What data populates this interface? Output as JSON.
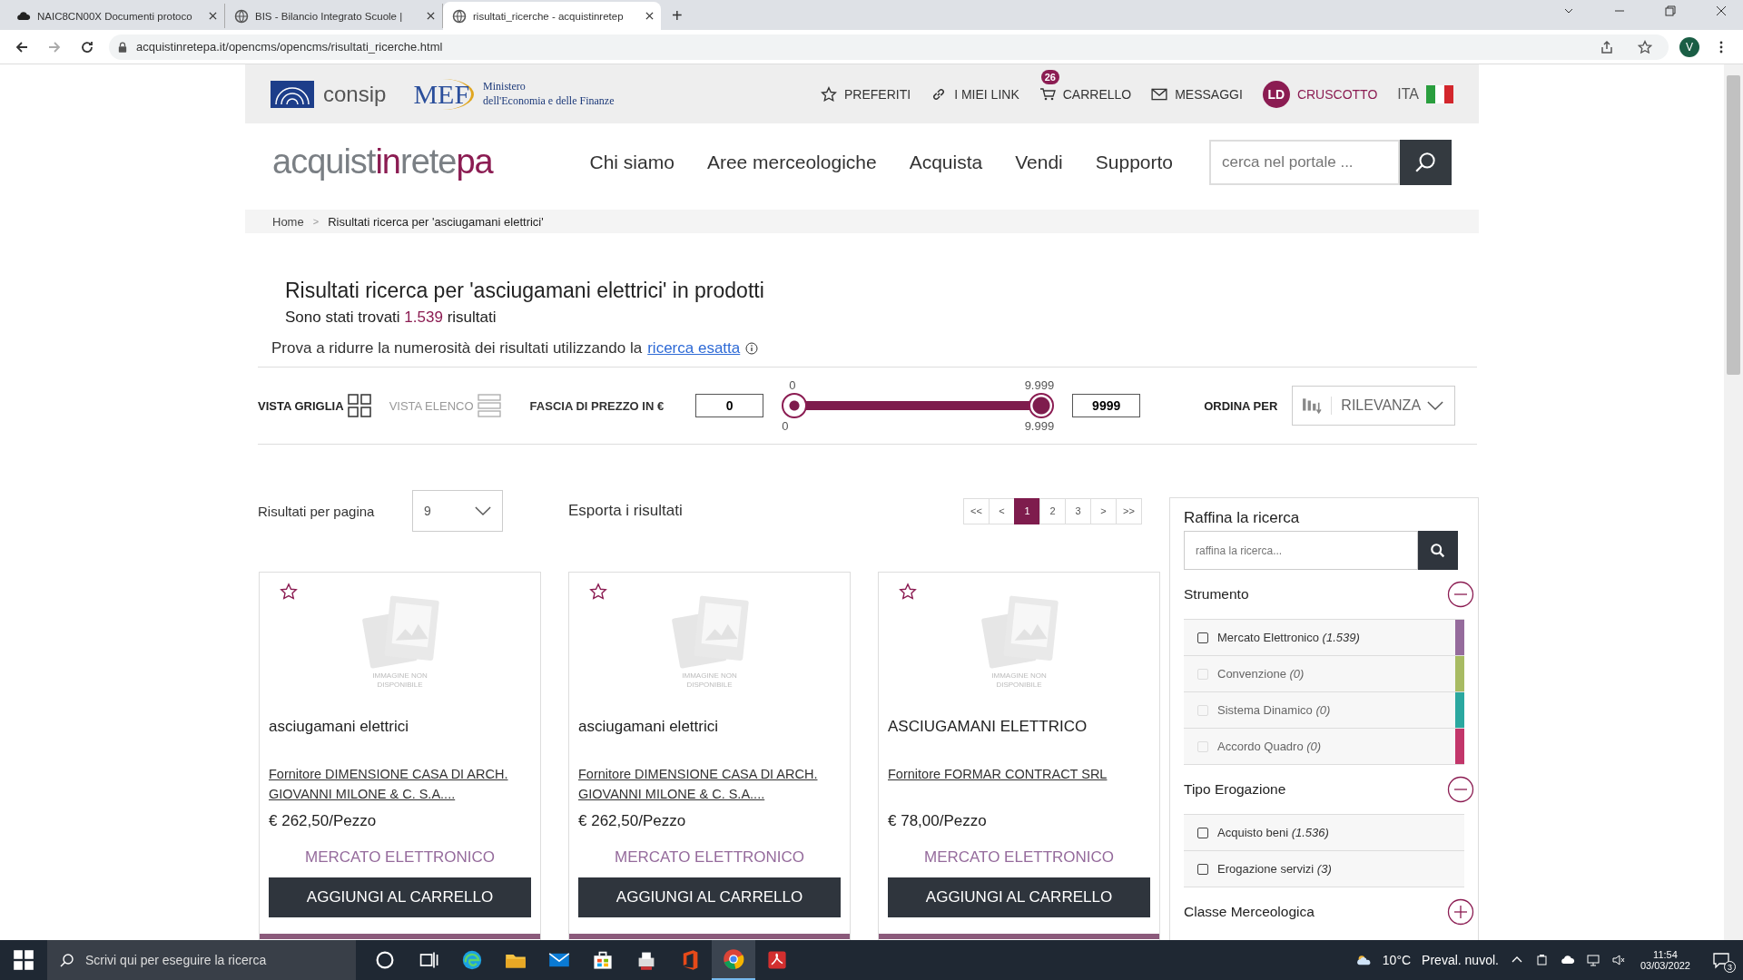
{
  "browser": {
    "tabs": [
      {
        "title": "NAIC8CN00X Documenti protoco",
        "selected": false
      },
      {
        "title": "BIS - Bilancio Integrato Scuole |",
        "selected": false
      },
      {
        "title": "risultati_ricerche - acquistinretep",
        "selected": true
      }
    ],
    "new_tab": "+",
    "url": "acquistinretepa.it/opencms/opencms/risultati_ricerche.html",
    "profile": "V"
  },
  "topbar": {
    "consip": "consip",
    "mef": "MEF",
    "ministry": [
      "Ministero",
      "dell'Economia e delle Finanze"
    ],
    "links": [
      {
        "label": "PREFERITI",
        "kind": "star"
      },
      {
        "label": "I MIEI LINK",
        "kind": "link"
      },
      {
        "label": "CARRELLO",
        "kind": "cart",
        "badge": "26"
      },
      {
        "label": "MESSAGGI",
        "kind": "mail"
      },
      {
        "label": "CRUSCOTTO",
        "kind": "avatar",
        "avatar": "LD"
      }
    ],
    "language": "ITA"
  },
  "header": {
    "logo": [
      {
        "text": "acquist",
        "accent": false
      },
      {
        "text": "in",
        "accent": true
      },
      {
        "text": "rete",
        "accent": false
      },
      {
        "text": "pa",
        "accent": true
      }
    ],
    "nav": [
      "Chi siamo",
      "Aree merceologiche",
      "Acquista",
      "Vendi",
      "Supporto"
    ],
    "search_placeholder": "cerca nel portale ..."
  },
  "breadcrumb": {
    "items": [
      "Home",
      "Risultati ricerca per 'asciugamani elettrici'"
    ],
    "separator": ">"
  },
  "results": {
    "title": "Risultati ricerca per 'asciugamani elettrici' in prodotti",
    "count_prefix": "Sono stati trovati",
    "count": "1.539",
    "count_suffix": "risultati",
    "hint": "Prova a ridurre la numerosità dei risultati utilizzando la",
    "hint_link": "ricerca esatta"
  },
  "filters": {
    "views": [
      {
        "label": "VISTA GRIGLIA",
        "kind": "grid",
        "selected": true
      },
      {
        "label": "VISTA ELENCO",
        "kind": "list",
        "selected": false
      }
    ],
    "price_label": "FASCIA DI PREZZO IN €",
    "price_min": "0",
    "price_max": "9999",
    "slider": {
      "top_low": "0",
      "top_high": "9.999",
      "bottom_low": "0",
      "bottom_high": "9.999",
      "thumbs": [
        {
          "level": 0
        },
        {
          "level": 1
        }
      ]
    },
    "sort_label": "ORDINA PER",
    "sort_value": "RILEVANZA"
  },
  "listing": {
    "per_page_label": "Risultati per pagina",
    "per_page": "9",
    "export": "Esporta i risultati",
    "pagination": [
      {
        "label": "<<",
        "selected": false
      },
      {
        "label": "<",
        "selected": false
      },
      {
        "label": "1",
        "selected": true
      },
      {
        "label": "2",
        "selected": false
      },
      {
        "label": "3",
        "selected": false
      },
      {
        "label": ">",
        "selected": false
      },
      {
        "label": ">>",
        "selected": false
      }
    ]
  },
  "products": [
    {
      "image_text": "IMMAGINE NON DISPONIBILE",
      "name": "asciugamani elettrici",
      "supplier": "Fornitore DIMENSIONE CASA DI ARCH. GIOVANNI MILONE & C. S.A....",
      "price": "€ 262,50/Pezzo",
      "channel": "MERCATO ELETTRONICO",
      "button": "AGGIUNGI AL CARRELLO"
    },
    {
      "image_text": "IMMAGINE NON DISPONIBILE",
      "name": "asciugamani elettrici",
      "supplier": "Fornitore DIMENSIONE CASA DI ARCH. GIOVANNI MILONE & C. S.A....",
      "price": "€ 262,50/Pezzo",
      "channel": "MERCATO ELETTRONICO",
      "button": "AGGIUNGI AL CARRELLO"
    },
    {
      "image_text": "IMMAGINE NON DISPONIBILE",
      "name": "ASCIUGAMANI ELETTRICO",
      "supplier": "Fornitore FORMAR CONTRACT SRL",
      "price": "€ 78,00/Pezzo",
      "channel": "MERCATO ELETTRONICO",
      "button": "AGGIUNGI AL CARRELLO"
    }
  ],
  "sidebar": {
    "title": "Raffina la ricerca",
    "placeholder": "raffina la ricerca...",
    "sections": [
      {
        "title": "Strumento",
        "expanded": true,
        "options": [
          {
            "label": "Mercato Elettronico",
            "count": "(1.539)",
            "checked": false,
            "disabled": false,
            "color": "#956b9c"
          },
          {
            "label": "Convenzione",
            "count": "(0)",
            "checked": false,
            "disabled": true,
            "color": "#a8bb63"
          },
          {
            "label": "Sistema Dinamico",
            "count": "(0)",
            "checked": false,
            "disabled": true,
            "color": "#2ba8a0"
          },
          {
            "label": "Accordo Quadro",
            "count": "(0)",
            "checked": false,
            "disabled": true,
            "color": "#c2366a"
          }
        ]
      },
      {
        "title": "Tipo Erogazione",
        "expanded": true,
        "options": [
          {
            "label": "Acquisto beni",
            "count": "(1.536)",
            "checked": false,
            "disabled": false
          },
          {
            "label": "Erogazione servizi",
            "count": "(3)",
            "checked": false,
            "disabled": false
          }
        ]
      },
      {
        "title": "Classe Merceologica",
        "expanded": false
      }
    ]
  },
  "taskbar": {
    "search_placeholder": "Scrivi qui per eseguire la ricerca",
    "temperature": "10°C",
    "weather": "Preval. nuvol.",
    "time": "11:54",
    "date": "03/03/2022",
    "notifications": "3"
  }
}
